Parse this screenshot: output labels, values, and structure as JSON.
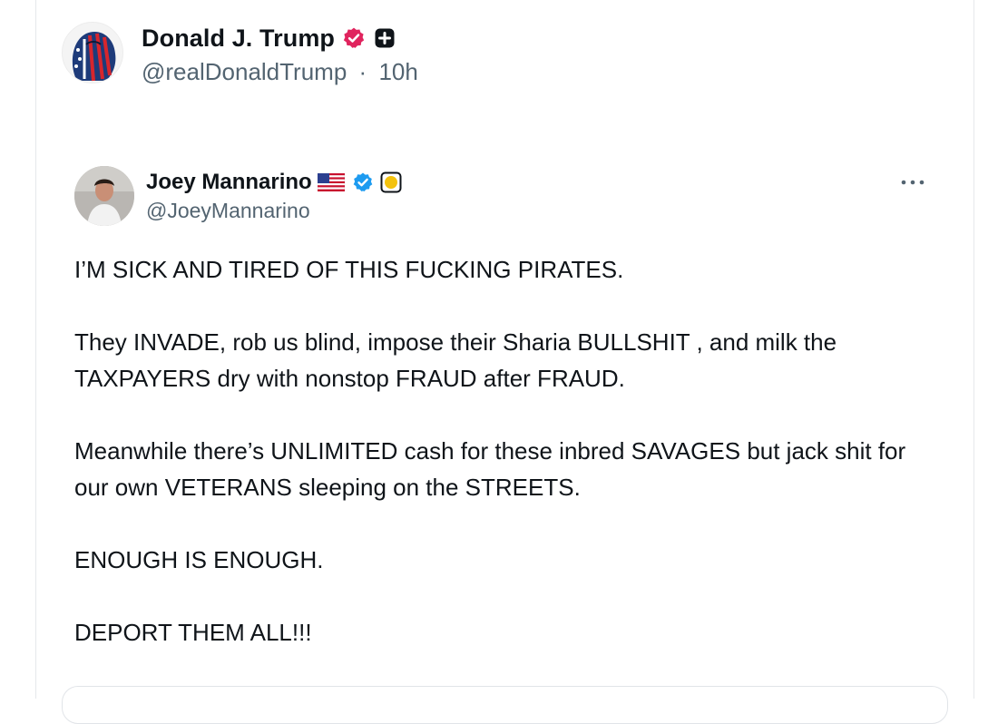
{
  "post": {
    "author_name": "Donald J. Trump",
    "handle": "@realDonaldTrump",
    "separator": "·",
    "time": "10h",
    "verified_icon": "verified-badge-icon",
    "extra_icon": "plus-square-icon",
    "accent_color": "#e0245e"
  },
  "quoted": {
    "author_name": "Joey Mannarino",
    "handle": "@JoeyMannarino",
    "verified_color": "#1d9bf0",
    "icons": [
      "us-flag-icon",
      "verified-badge-icon",
      "affiliate-badge-icon",
      "more-icon"
    ],
    "paragraphs": [
      "I’M SICK AND TIRED OF THIS FUCKING PIRATES.",
      "They INVADE, rob us blind, impose their Sharia BULLSHIT , and milk the TAXPAYERS dry with nonstop FRAUD after FRAUD.",
      "Meanwhile there’s UNLIMITED cash for these inbred SAVAGES but jack shit for our own VETERANS sleeping on the STREETS.",
      "ENOUGH IS ENOUGH.",
      "DEPORT THEM ALL!!!"
    ]
  }
}
